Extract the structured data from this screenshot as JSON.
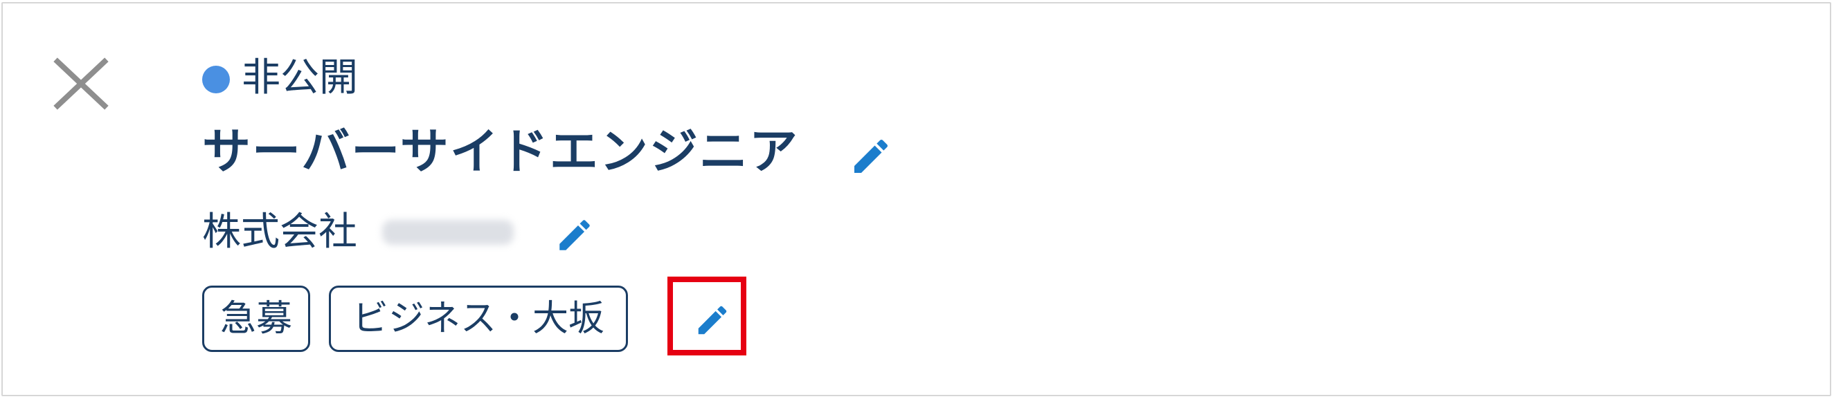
{
  "colors": {
    "text": "#1b3d64",
    "accent": "#1b7dcc",
    "status_dot": "#4a90e2",
    "close_icon": "#8e8e8e",
    "highlight": "#e60012",
    "border": "#d6d6d6"
  },
  "icons": {
    "close": "close-icon",
    "edit": "pencil-icon"
  },
  "status": {
    "label": "非公開"
  },
  "job": {
    "title": "サーバーサイドエンジニア",
    "company": "株式会社"
  },
  "tags": [
    {
      "label": "急募"
    },
    {
      "label": "ビジネス・大坂"
    }
  ]
}
